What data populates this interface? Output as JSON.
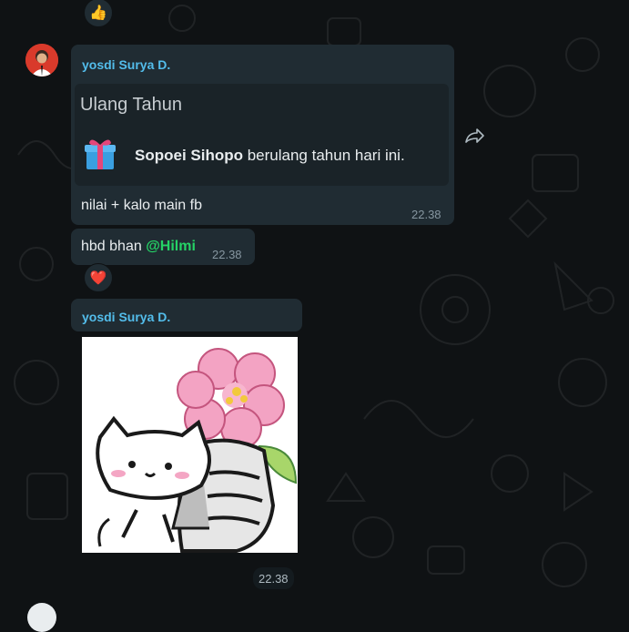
{
  "colors": {
    "background": "#0f1214",
    "bubble": "#202c33",
    "sender_name": "#53bdeb",
    "mention": "#25d366",
    "timestamp": "#8696a0"
  },
  "reactions": {
    "top": "👍",
    "heart": "❤️"
  },
  "messages": [
    {
      "sender": "yosdi Surya D.",
      "card": {
        "title": "Ulang Tahun",
        "icon": "gift-icon",
        "name": "Sopoei Sihopo",
        "text": " berulang tahun hari ini."
      },
      "text": "nilai + kalo main fb",
      "time": "22.38"
    },
    {
      "text": "hbd bhan ",
      "mention": "@Hilmi",
      "time": "22.38"
    },
    {
      "sender": "yosdi Surya D.",
      "sticker": "cat-holding-flower-sticker",
      "time": "22.38"
    }
  ],
  "icons": {
    "forward": "forward-arrow-icon"
  }
}
